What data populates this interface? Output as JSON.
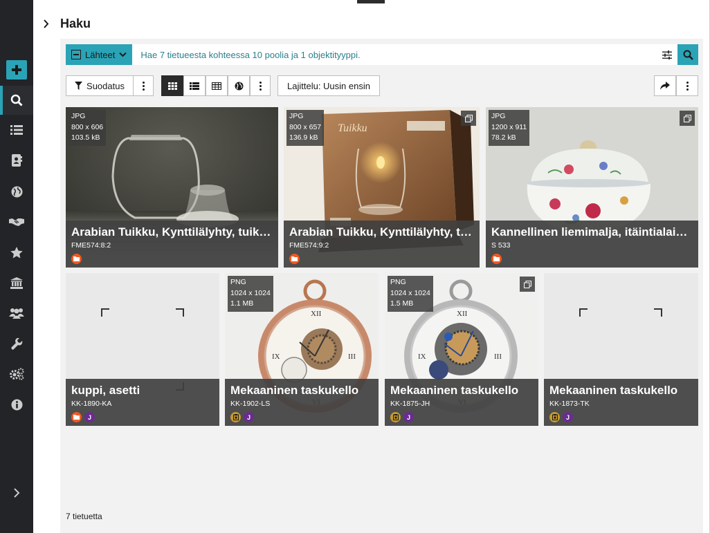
{
  "header": {
    "title": "Haku"
  },
  "search": {
    "sources_label": "Lähteet",
    "placeholder": "Hae 7 tietueesta kohteessa 10 poolia ja 1 objektityyppi."
  },
  "toolbar": {
    "filter_label": "Suodatus",
    "sort_label": "Lajittelu: Uusin ensin"
  },
  "cards": [
    {
      "format": "JPG",
      "size": "800 x 606",
      "filesize": "103.5 kB",
      "title": "Arabian Tuikku, Kynttilälyhty, tuikkulyhty",
      "id": "FME574:8:2",
      "multi": false,
      "badges": [
        "folder"
      ]
    },
    {
      "format": "JPG",
      "size": "800 x 657",
      "filesize": "136.9 kB",
      "title": "Arabian Tuikku, Kynttilälyhty, tuikkulyhty",
      "id": "FME574:9:2",
      "multi": true,
      "badges": [
        "folder"
      ]
    },
    {
      "format": "JPG",
      "size": "1200 x 911",
      "filesize": "78.2 kB",
      "title": "Kannellinen liemimalja, itäintialainen",
      "id": "S 533",
      "multi": true,
      "badges": [
        "folder"
      ]
    },
    {
      "format": "",
      "size": "",
      "filesize": "",
      "title": "kuppi, asetti",
      "id": "KK-1890-KA",
      "multi": false,
      "badges": [
        "folder",
        "J"
      ]
    },
    {
      "format": "PNG",
      "size": "1024 x 1024",
      "filesize": "1.1 MB",
      "title": "Mekaaninen taskukello",
      "id": "KK-1902-LS",
      "multi": false,
      "badges": [
        "gold",
        "J"
      ]
    },
    {
      "format": "PNG",
      "size": "1024 x 1024",
      "filesize": "1.5 MB",
      "title": "Mekaaninen taskukello",
      "id": "KK-1875-JH",
      "multi": true,
      "badges": [
        "gold",
        "J"
      ]
    },
    {
      "format": "",
      "size": "",
      "filesize": "",
      "title": "Mekaaninen taskukello",
      "id": "KK-1873-TK",
      "multi": false,
      "badges": [
        "gold",
        "J"
      ]
    }
  ],
  "footer": {
    "count": "7 tietuetta"
  },
  "colors": {
    "accent": "#2ba3b6",
    "sidebar": "#222427",
    "badge_orange": "#ef5a24",
    "badge_purple": "#6a2c91",
    "badge_gold": "#c79a2e"
  }
}
